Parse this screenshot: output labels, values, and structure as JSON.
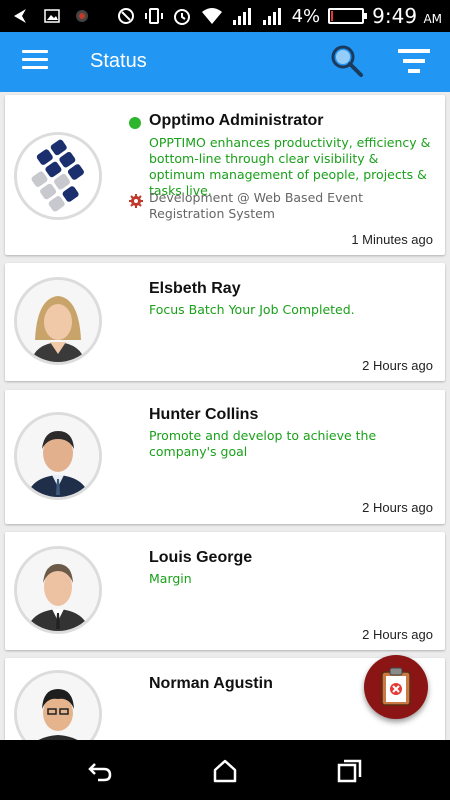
{
  "status_bar": {
    "battery": "4%",
    "time": "9:49",
    "ampm": "AM"
  },
  "app_bar": {
    "title": "Status"
  },
  "feed": [
    {
      "name": "Opptimo Administrator",
      "message": "OPPTIMO enhances productivity, efficiency & bottom-line through clear visibility & optimum management of people, projects & tasks live.",
      "project": "Development @ Web Based Event Registration System",
      "time": "1 Minutes ago",
      "online": true
    },
    {
      "name": "Elsbeth Ray",
      "message": "Focus Batch Your Job Completed.",
      "time": "2 Hours ago"
    },
    {
      "name": "Hunter Collins",
      "message": "Promote and develop to achieve the company's goal",
      "time": "2 Hours ago"
    },
    {
      "name": "Louis George",
      "message": "Margin",
      "time": "2 Hours ago"
    },
    {
      "name": "Norman Agustin",
      "message": "",
      "time": ""
    }
  ],
  "colors": {
    "app_bar": "#2196f3",
    "message_text": "#1aa01a",
    "online_dot": "#2db52d",
    "fab": "#8b1414"
  },
  "icons": {
    "menu": "hamburger-menu-icon",
    "search": "search-icon",
    "filter": "filter-icon",
    "fab": "clipboard-icon",
    "back": "back-icon",
    "home": "home-icon",
    "recents": "recents-icon"
  }
}
